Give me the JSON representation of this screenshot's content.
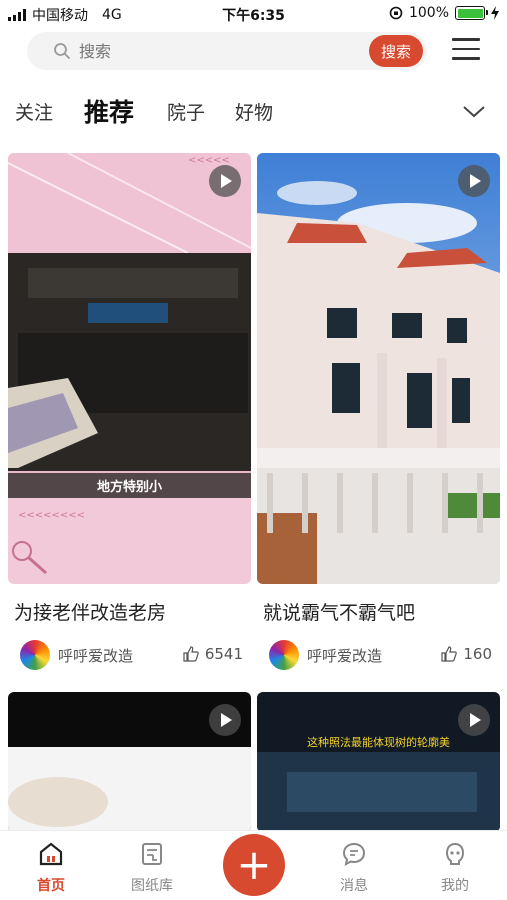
{
  "status_bar": {
    "carrier": "中国移动",
    "network": "4G",
    "time": "下午6:35",
    "battery": "100%",
    "battery_level": 1.0
  },
  "search": {
    "placeholder": "搜索",
    "button_label": "搜索"
  },
  "tabs": [
    {
      "label": "关注",
      "active": false
    },
    {
      "label": "推荐",
      "active": true
    },
    {
      "label": "院子",
      "active": false
    },
    {
      "label": "好物",
      "active": false
    }
  ],
  "feed": [
    {
      "title": "为接老伴改造老房",
      "author": "呼呼爱改造",
      "likes": "6541",
      "overlay_caption": "地方特别小"
    },
    {
      "title": "就说霸气不霸气吧",
      "author": "呼呼爱改造",
      "likes": "160"
    },
    {
      "title": "",
      "author": "",
      "likes": ""
    },
    {
      "title": "",
      "author": "",
      "likes": "",
      "overlay_caption": "这种照法最能体现树的轮廓美"
    }
  ],
  "bottom_nav": [
    {
      "label": "首页",
      "icon": "home-icon",
      "active": true
    },
    {
      "label": "图纸库",
      "icon": "blueprint-icon",
      "active": false
    },
    {
      "label": "+",
      "icon": "add-icon",
      "active": false
    },
    {
      "label": "消息",
      "icon": "message-icon",
      "active": false
    },
    {
      "label": "我的",
      "icon": "profile-icon",
      "active": false
    }
  ],
  "colors": {
    "accent": "#d84a2f",
    "card1_bg": "#f2c9d8",
    "battery": "#3cc03c"
  }
}
